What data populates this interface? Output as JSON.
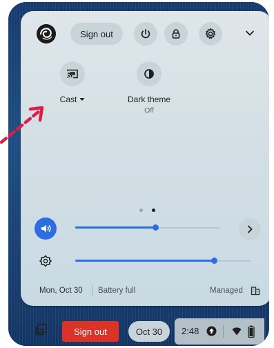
{
  "colors": {
    "accent": "#2c6de0",
    "signout_red": "#d93427",
    "arrow": "#d91e48"
  },
  "header": {
    "signout_label": "Sign out",
    "icons": [
      "avatar",
      "power-icon",
      "lock-icon",
      "gear-icon",
      "chevron-down-icon"
    ]
  },
  "tiles": [
    {
      "label": "Cast",
      "sublabel": "",
      "icon": "cast-icon",
      "has_dropdown": true
    },
    {
      "label": "Dark theme",
      "sublabel": "Off",
      "icon": "dark-theme-icon",
      "has_dropdown": false
    }
  ],
  "pagination": {
    "pages": 2,
    "current": 2
  },
  "volume": {
    "level": 0.55,
    "icon": "volume-icon"
  },
  "brightness": {
    "level": 0.79,
    "icon": "brightness-icon"
  },
  "footer": {
    "date": "Mon, Oct 30",
    "battery": "Battery full",
    "managed": "Managed",
    "managed_icon": "building-icon"
  },
  "shelf": {
    "signout_label": "Sign out",
    "date": "Oct 30",
    "time": "2:48",
    "icons": [
      "screenshot-capture-icon",
      "update-icon",
      "wifi-icon",
      "battery-icon"
    ]
  }
}
